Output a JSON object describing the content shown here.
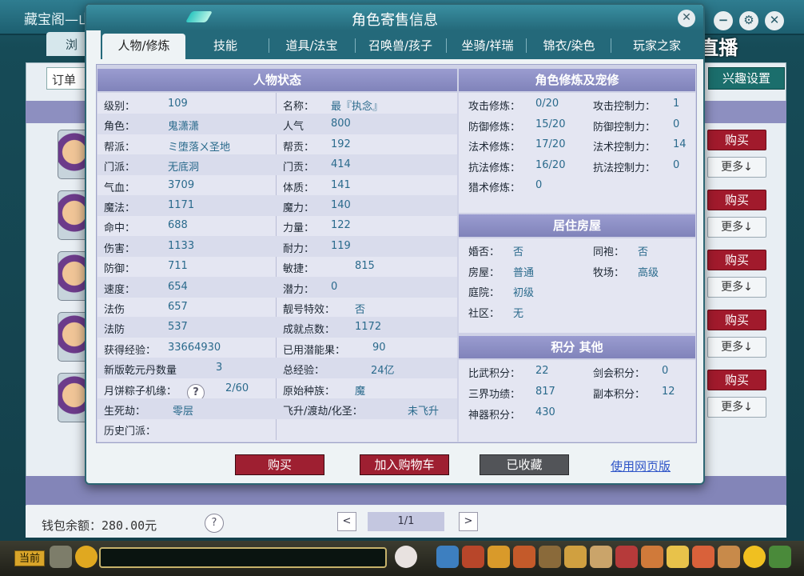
{
  "background": {
    "window_title": "藏宝阁—山",
    "tab_partial": "浏",
    "search_partial": "订单",
    "interest_button": "兴趣设置",
    "buy_label": "购买",
    "more_label": "更多↓",
    "wallet_text": "钱包余额：280.00元",
    "help": "?",
    "pager_text": "1/1",
    "pager_prev": "<",
    "pager_next": ">",
    "logo_text": "CC直播",
    "chat_label": "当前",
    "window_controls": [
      "minimize-icon",
      "settings-icon",
      "close-icon"
    ]
  },
  "dialog": {
    "title": "角色寄售信息",
    "close": "✕",
    "tabs": [
      "人物/修炼",
      "技能",
      "道具/法宝",
      "召唤兽/孩子",
      "坐骑/祥瑞",
      "锦衣/染色",
      "玩家之家"
    ],
    "active_tab": 0,
    "status": {
      "title": "人物状态",
      "left": [
        {
          "label": "级别：",
          "value": "109"
        },
        {
          "label": "角色：",
          "value": "鬼潇潇"
        },
        {
          "label": "帮派：",
          "value": "ミ堕落ㄨ圣地"
        },
        {
          "label": "门派：",
          "value": "无底洞"
        },
        {
          "label": "气血：",
          "value": "3709"
        },
        {
          "label": "魔法：",
          "value": "1171"
        },
        {
          "label": "命中：",
          "value": "688"
        },
        {
          "label": "伤害：",
          "value": "1133"
        },
        {
          "label": "防御：",
          "value": "711"
        },
        {
          "label": "速度：",
          "value": "654"
        },
        {
          "label": "法伤",
          "value": "657"
        },
        {
          "label": "法防",
          "value": "537"
        },
        {
          "label": "获得经验：",
          "value": "33664930"
        },
        {
          "label": "新版乾元丹数量",
          "value": "3"
        },
        {
          "label": "月饼粽子机缘：",
          "value": "2/60"
        },
        {
          "label": "生死劫：",
          "value": "零层"
        },
        {
          "label": "历史门派：",
          "value": ""
        }
      ],
      "right": [
        {
          "label": "名称：",
          "value": "最『执念』"
        },
        {
          "label": "人气",
          "value": "800"
        },
        {
          "label": "帮贡：",
          "value": "192"
        },
        {
          "label": "门贡：",
          "value": "414"
        },
        {
          "label": "体质：",
          "value": "141"
        },
        {
          "label": "魔力：",
          "value": "140"
        },
        {
          "label": "力量：",
          "value": "122"
        },
        {
          "label": "耐力：",
          "value": "119"
        },
        {
          "label": "敏捷：",
          "value": "815"
        },
        {
          "label": "潜力：",
          "value": "0"
        },
        {
          "label": "靓号特效：",
          "value": "否"
        },
        {
          "label": "成就点数：",
          "value": "1172"
        },
        {
          "label": "已用潜能果：",
          "value": "90"
        },
        {
          "label": "总经验：",
          "value": "24亿"
        },
        {
          "label": "原始种族：",
          "value": "魔"
        },
        {
          "label": "飞升/渡劫/化圣：",
          "value": "未飞升"
        }
      ]
    },
    "cultivation": {
      "title": "角色修炼及宠修",
      "rows": [
        {
          "l1": "攻击修炼：",
          "v1": "0/20",
          "l2": "攻击控制力：",
          "v2": "1"
        },
        {
          "l1": "防御修炼：",
          "v1": "15/20",
          "l2": "防御控制力：",
          "v2": "0"
        },
        {
          "l1": "法术修炼：",
          "v1": "17/20",
          "l2": "法术控制力：",
          "v2": "14"
        },
        {
          "l1": "抗法修炼：",
          "v1": "16/20",
          "l2": "抗法控制力：",
          "v2": "0"
        },
        {
          "l1": "猎术修炼：",
          "v1": "0",
          "l2": "",
          "v2": ""
        }
      ]
    },
    "housing": {
      "title": "居住房屋",
      "rows": [
        {
          "l1": "婚否：",
          "v1": "否",
          "l2": "同袍：",
          "v2": "否"
        },
        {
          "l1": "房屋：",
          "v1": "普通",
          "l2": "牧场：",
          "v2": "高级"
        },
        {
          "l1": "庭院：",
          "v1": "初级",
          "l2": "",
          "v2": ""
        },
        {
          "l1": "社区：",
          "v1": "无",
          "l2": "",
          "v2": ""
        }
      ]
    },
    "points": {
      "title": "积分 其他",
      "rows": [
        {
          "l1": "比武积分：",
          "v1": "22",
          "l2": "剑会积分：",
          "v2": "0"
        },
        {
          "l1": "三界功绩：",
          "v1": "817",
          "l2": "副本积分：",
          "v2": "12"
        },
        {
          "l1": "神器积分：",
          "v1": "430",
          "l2": "",
          "v2": ""
        }
      ]
    },
    "actions": {
      "buy": "购买",
      "add_cart": "加入购物车",
      "saved": "已收藏",
      "web_link": "使用网页版"
    }
  }
}
